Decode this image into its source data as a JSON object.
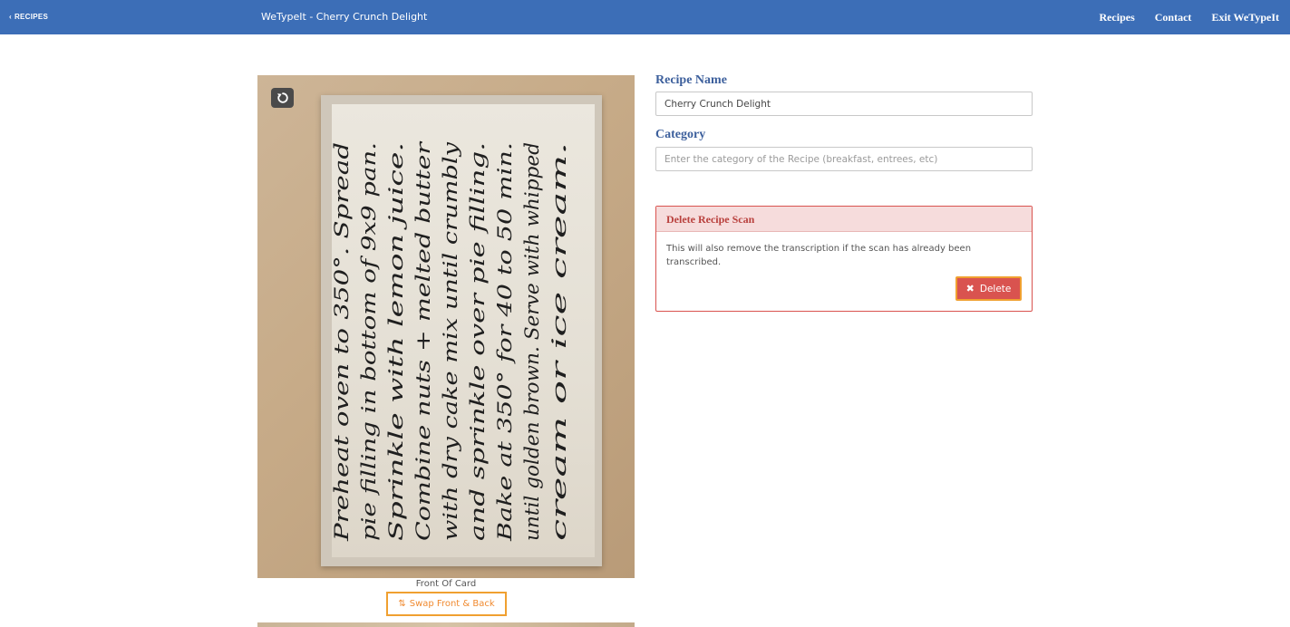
{
  "topbar": {
    "back_label": "RECIPES",
    "app_title": "WeTypeIt - Cherry Crunch Delight",
    "nav": [
      "Recipes",
      "Contact",
      "Exit WeTypeIt"
    ]
  },
  "scan": {
    "caption": "Front Of Card",
    "swap_label": "Swap Front & Back",
    "card_lines": [
      "Preheat oven to 350°. Spread",
      "pie filling in bottom of 9x9 pan.",
      "Sprinkle with lemon juice.",
      "Combine nuts + melted butter",
      "with dry cake mix until crumbly",
      "and sprinkle over pie filling.",
      "Bake at 350° for 40 to 50 min.",
      "until golden brown. Serve with whipped",
      "cream or ice cream."
    ]
  },
  "form": {
    "name_label": "Recipe Name",
    "name_value": "Cherry Crunch Delight",
    "category_label": "Category",
    "category_placeholder": "Enter the category of the Recipe (breakfast, entrees, etc)"
  },
  "delete_panel": {
    "title": "Delete Recipe Scan",
    "message": "This will also remove the transcription if the scan has already been transcribed.",
    "button_label": "Delete"
  },
  "colors": {
    "topbar": "#3c6eb7",
    "label": "#3c5f9c",
    "danger": "#d9534f",
    "focus": "#f0a030",
    "swap_text": "#f08a30"
  }
}
